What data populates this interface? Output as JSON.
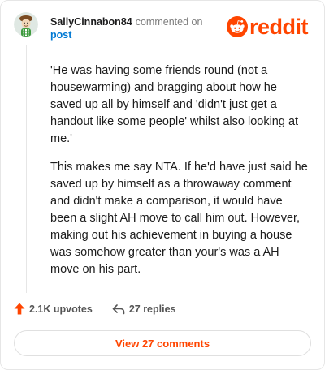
{
  "comment": {
    "author": "SallyCinnabon84",
    "action": "commented on",
    "target": "post",
    "paragraphs": [
      "'He was having some friends round (not a housewarming) and bragging about how he saved up all by himself and 'didn't just get a handout like some people' whilst also looking at me.'",
      "This makes me say NTA. If he'd have just said he saved up by himself as a throwaway comment and didn't make a comparison, it would have been a slight AH move to call him out. However, making out his achievement in buying a house was somehow greater than your's was a AH move on his part."
    ]
  },
  "brand": {
    "name": "reddit",
    "color": "#ff4500",
    "icon": "reddit-alien-icon"
  },
  "actions": {
    "upvotes": "2.1K upvotes",
    "replies": "27 replies"
  },
  "footer": {
    "view_comments": "View 27 comments"
  },
  "colors": {
    "accent": "#ff4500",
    "link": "#0079d3",
    "muted": "#7c7c7c"
  }
}
